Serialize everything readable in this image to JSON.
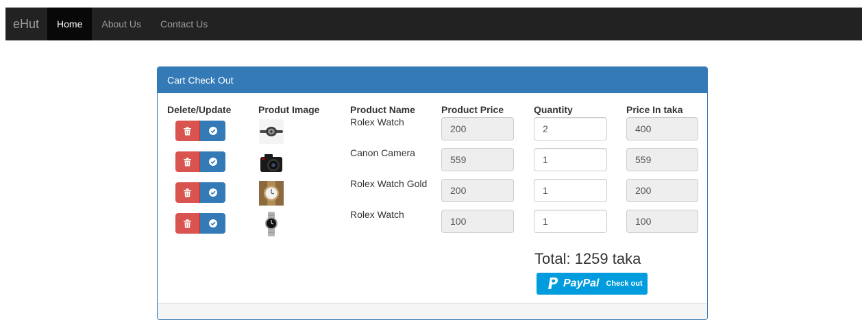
{
  "navbar": {
    "brand": "eHut",
    "items": [
      {
        "label": "Home",
        "active": true
      },
      {
        "label": "About Us",
        "active": false
      },
      {
        "label": "Contact Us",
        "active": false
      }
    ]
  },
  "panel": {
    "title": "Cart Check Out",
    "headers": [
      "Delete/Update",
      "Produt Image",
      "Product Name",
      "Product Price",
      "Quantity",
      "Price In taka"
    ],
    "rows": [
      {
        "name": "Rolex Watch",
        "price": "200",
        "quantity": "2",
        "total": "400",
        "image": "watch-image"
      },
      {
        "name": "Canon Camera",
        "price": "559",
        "quantity": "1",
        "total": "559",
        "image": "camera-image"
      },
      {
        "name": "Rolex Watch Gold",
        "price": "200",
        "quantity": "1",
        "total": "200",
        "image": "gold-watch-image"
      },
      {
        "name": "Rolex Watch",
        "price": "100",
        "quantity": "1",
        "total": "100",
        "image": "steel-watch-image"
      }
    ],
    "total_text": "Total: 1259 taka",
    "paypal": {
      "brand": "PayPal",
      "action": "Check out"
    }
  },
  "colors": {
    "navbar": "#222222",
    "primary": "#337ab7",
    "danger": "#d9534f",
    "paypal": "#009cde"
  },
  "icons": {
    "delete": "trash-icon",
    "update": "check-circle-icon",
    "paypal": "paypal-logo-icon"
  }
}
